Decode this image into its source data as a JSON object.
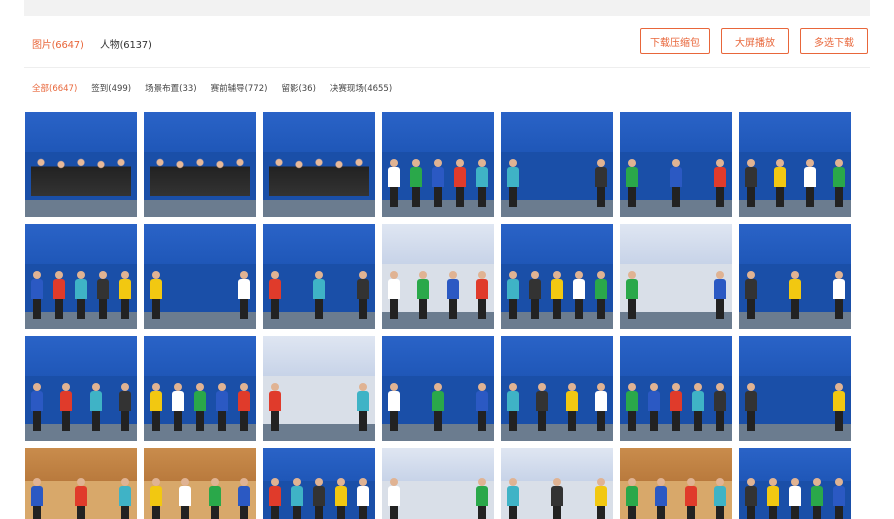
{
  "main_tabs": [
    {
      "label": "图片(6647)",
      "active": true
    },
    {
      "label": "人物(6137)",
      "active": false
    }
  ],
  "actions": {
    "download_zip": "下载压缩包",
    "slideshow": "大屏播放",
    "multi_download": "多选下载"
  },
  "filters": [
    {
      "label": "全部(6647)",
      "active": true
    },
    {
      "label": "签到(499)",
      "active": false
    },
    {
      "label": "场景布置(33)",
      "active": false
    },
    {
      "label": "赛前辅导(772)",
      "active": false
    },
    {
      "label": "留影(36)",
      "active": false
    },
    {
      "label": "决赛现场(4655)",
      "active": false
    }
  ],
  "photos": {
    "row_count": 4,
    "column_count": 7
  },
  "colors": {
    "accent": "#e8663a",
    "banner_blue": "#1f57b8"
  }
}
